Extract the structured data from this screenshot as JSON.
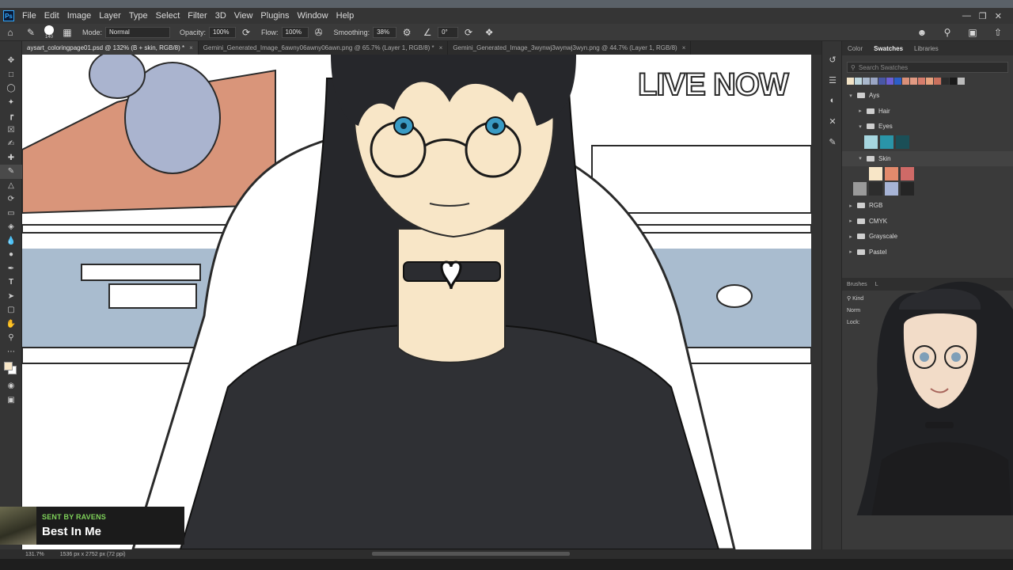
{
  "app": {
    "logo": "Ps",
    "menu": [
      "File",
      "Edit",
      "Image",
      "Layer",
      "Type",
      "Select",
      "Filter",
      "3D",
      "View",
      "Plugins",
      "Window",
      "Help"
    ]
  },
  "options_bar": {
    "brush_size": "140",
    "mode_label": "Mode:",
    "mode_value": "Normal",
    "opacity_label": "Opacity:",
    "opacity_value": "100%",
    "flow_label": "Flow:",
    "flow_value": "100%",
    "smoothing_label": "Smoothing:",
    "smoothing_value": "38%",
    "angle_value": "0°"
  },
  "tabs": [
    {
      "label": "aysart_coloringpage01.psd @ 132% (B + skin, RGB/8) *",
      "active": true
    },
    {
      "label": "Gemini_Generated_Image_6awny06awny06awn.png @ 65.7% (Layer 1, RGB/8) *",
      "active": false
    },
    {
      "label": "Gemini_Generated_Image_3wynwj3wynwj3wyn.png @ 44.7% (Layer 1, RGB/8)",
      "active": false
    }
  ],
  "canvas": {
    "live_text": "LIVE NOW"
  },
  "swatches_panel": {
    "tabs": [
      "Color",
      "Swatches",
      "Libraries"
    ],
    "active_tab": "Swatches",
    "search_placeholder": "Search Swatches",
    "recent": [
      "#f2e3c6",
      "#bdd6de",
      "#a9b8cc",
      "#9aa6c4",
      "#4957a6",
      "#6b5fd6",
      "#2c5ec7",
      "#d98f78",
      "#e29a83",
      "#d77d6c",
      "#e8a27e",
      "#c9705d",
      "#2b2b2b",
      "#1a1a1a",
      "#bbbbbb"
    ],
    "groups": [
      {
        "name": "Ays",
        "expanded": true,
        "level": 0
      },
      {
        "name": "Hair",
        "expanded": false,
        "level": 1
      },
      {
        "name": "Eyes",
        "expanded": true,
        "level": 1,
        "colors": [
          "#a6d6df",
          "#2a95a8",
          "#1b4f57"
        ]
      },
      {
        "name": "Skin",
        "expanded": true,
        "level": 1,
        "colors": [
          "#f8e6c7",
          "#e38a6c",
          "#cf6a67",
          "#9a9a9a",
          "#2d2d2d",
          "#a7b4d6",
          "#252525"
        ]
      },
      {
        "name": "RGB",
        "expanded": false,
        "level": 0
      },
      {
        "name": "CMYK",
        "expanded": false,
        "level": 0
      },
      {
        "name": "Grayscale",
        "expanded": false,
        "level": 0
      },
      {
        "name": "Pastel",
        "expanded": false,
        "level": 0
      }
    ]
  },
  "layers_panel": {
    "tabs": [
      "Brushes",
      "L"
    ],
    "kind_label": "Kind",
    "mode_label": "Norm",
    "lock_label": "Lock:"
  },
  "status": {
    "zoom": "131.7%",
    "doc_info": "1536 px x 2752 px (72 ppi)"
  },
  "alert": {
    "subtitle": "SENT BY RAVENS",
    "title": "Best In Me"
  }
}
